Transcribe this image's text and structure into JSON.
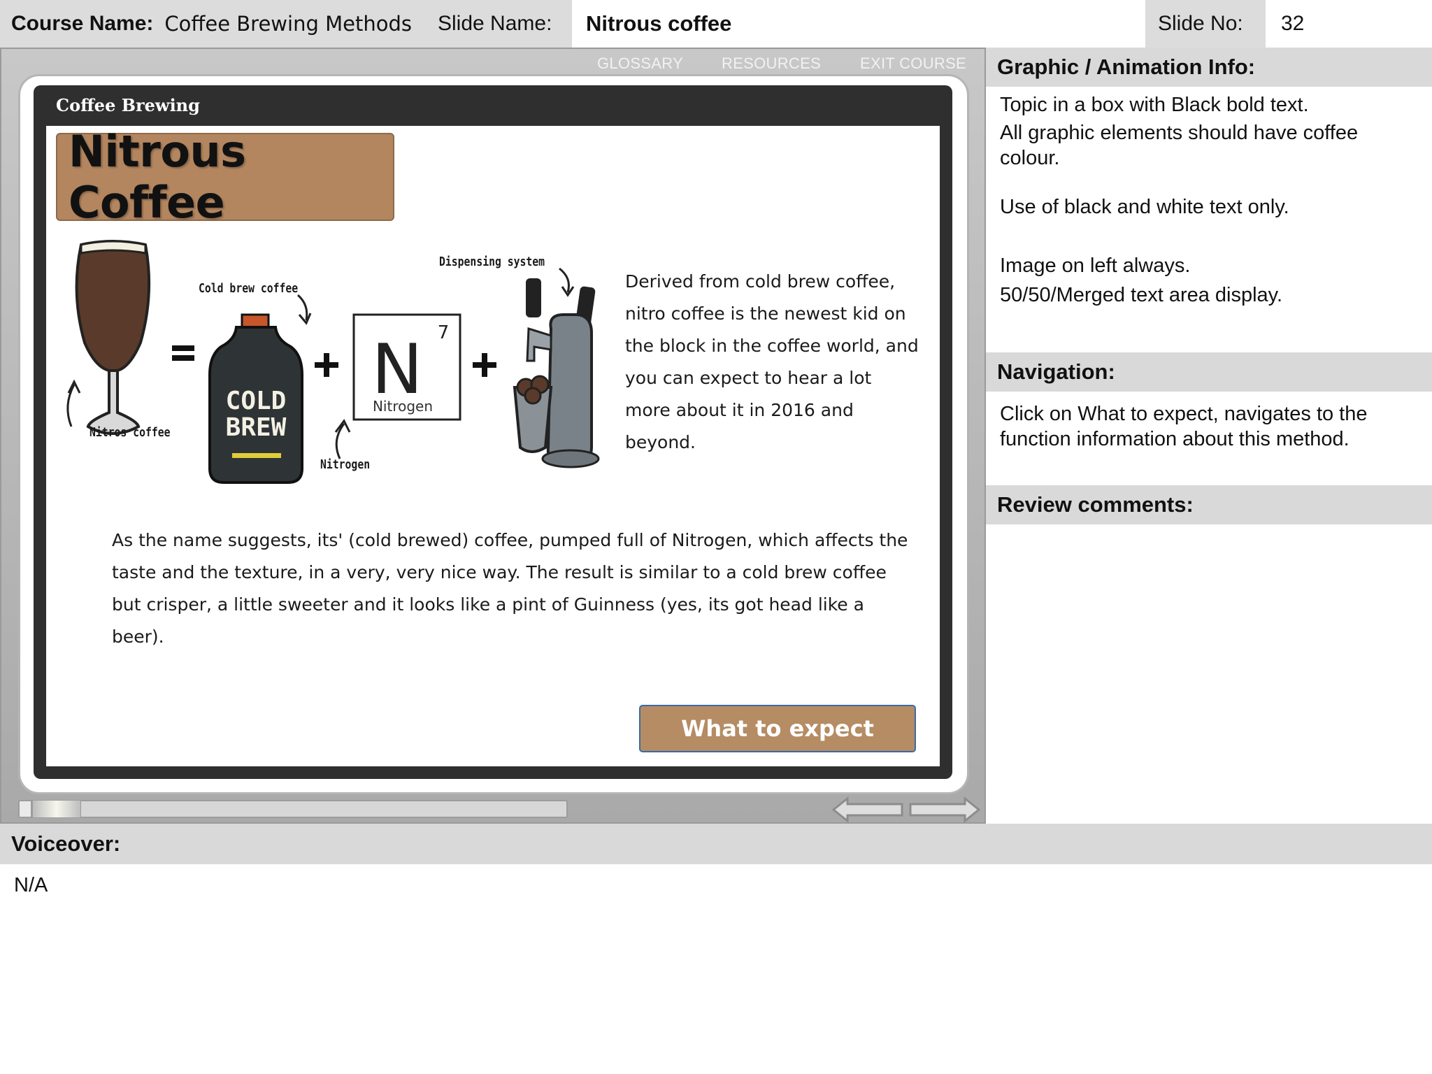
{
  "header": {
    "course_label": "Course Name:",
    "course_value": "Coffee Brewing Methods",
    "slide_name_label": "Slide Name:",
    "slide_name_value": "Nitrous coffee",
    "slide_no_label": "Slide No:",
    "slide_no_value": "32"
  },
  "player": {
    "nav": {
      "glossary": "GLOSSARY",
      "resources": "RESOURCES",
      "exit": "EXIT COURSE"
    },
    "slide_header": "Coffee Brewing",
    "topic": "Nitrous Coffee",
    "illustration": {
      "nitros_coffee": "Nitros coffee",
      "cold_brew_coffee": "Cold brew coffee",
      "cold_brew_can_line1": "COLD",
      "cold_brew_can_line2": "BREW",
      "nitrogen_symbol": "N",
      "nitrogen_number": "7",
      "nitrogen_name": "Nitrogen",
      "nitrogen_caption": "Nitrogen",
      "dispensing_system": "Dispensing system",
      "equals": "=",
      "plus": "+"
    },
    "side_text": "Derived from cold brew coffee, nitro coffee is the newest kid on the block in the coffee world, and you can expect to hear a lot more about it in 2016 and beyond.",
    "body_text": "As the name suggests, its' (cold brewed) coffee, pumped full of Nitrogen, which affects the taste and the texture, in a very, very nice way. The result is similar to a cold brew coffee but crisper, a little sweeter and it looks like a pint of Guinness (yes, its got head like a beer).",
    "cta_label": "What to expect",
    "colors": {
      "coffee": "#b3865f",
      "cta_border": "#3c6aa6",
      "slide_frame": "#2f2f2f"
    }
  },
  "panel": {
    "graphic_title": "Graphic / Animation Info:",
    "graphic_lines": [
      "Topic in a box with Black bold text.",
      "All graphic elements should have coffee colour.",
      "Use of black and white text only.",
      "Image on left always.",
      "50/50/Merged text area display."
    ],
    "navigation_title": "Navigation:",
    "navigation_text": "Click on What to expect, navigates to the function information about this method.",
    "review_title": "Review comments:"
  },
  "voiceover": {
    "title": "Voiceover:",
    "text": "N/A"
  }
}
